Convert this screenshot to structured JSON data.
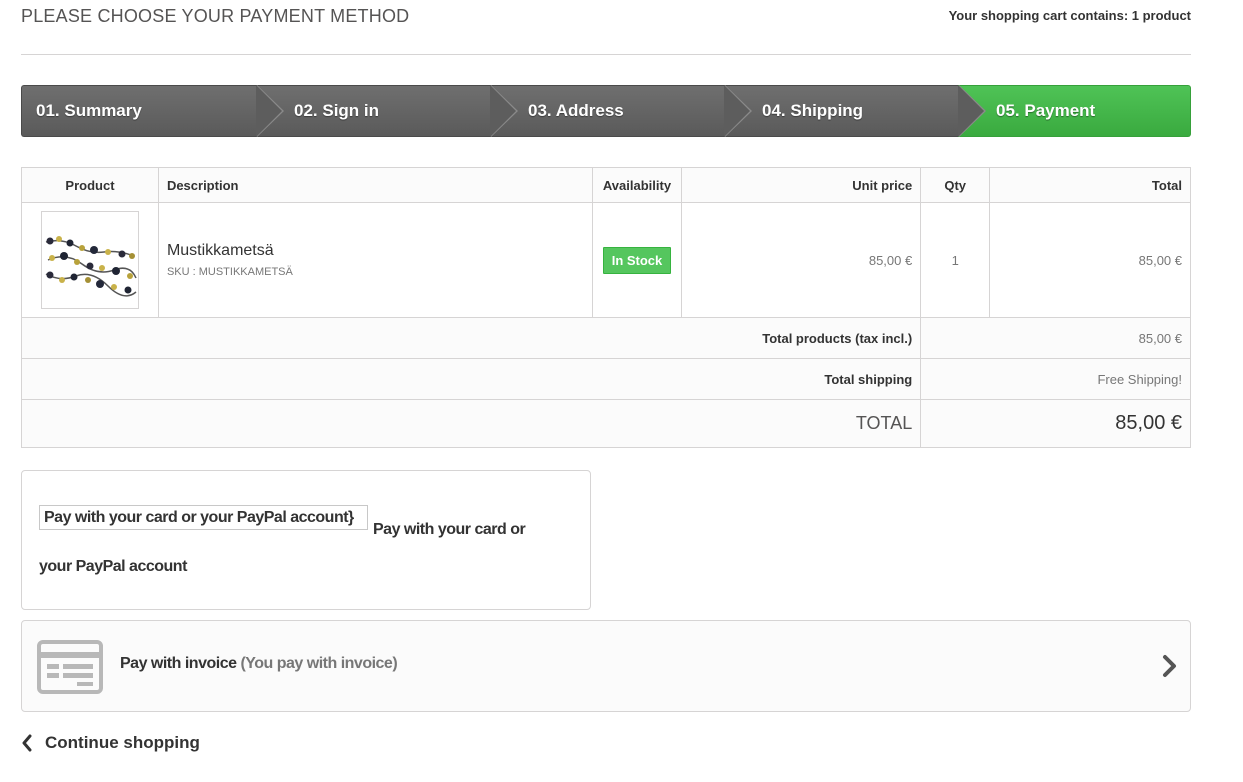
{
  "page": {
    "title": "Please choose your payment method",
    "cart_summary": "Your shopping cart contains: 1 product"
  },
  "steps": [
    {
      "label": "01. Summary",
      "state": "done"
    },
    {
      "label": "02. Sign in",
      "state": "done"
    },
    {
      "label": "03. Address",
      "state": "done"
    },
    {
      "label": "04. Shipping",
      "state": "done"
    },
    {
      "label": "05. Payment",
      "state": "current"
    }
  ],
  "table": {
    "headers": {
      "product": "Product",
      "description": "Description",
      "availability": "Availability",
      "unit_price": "Unit price",
      "qty": "Qty",
      "total": "Total"
    },
    "item": {
      "name": "Mustikkametsä",
      "sku": "SKU : MUSTIKKAMETSÄ",
      "availability": "In Stock",
      "unit_price": "85,00 €",
      "qty": "1",
      "total": "85,00 €"
    },
    "totals": {
      "products_label": "Total products (tax incl.)",
      "products_value": "85,00 €",
      "shipping_label": "Total shipping",
      "shipping_value": "Free Shipping!",
      "grand_label": "Total",
      "grand_value": "85,00 €"
    }
  },
  "payment": {
    "paypal": {
      "image_alt": "Pay with your card or your PayPal account}",
      "label": "Pay with your card or your PayPal account"
    },
    "invoice": {
      "label": "Pay with invoice",
      "sublabel": "(You pay with invoice)",
      "icon": "invoice-card-icon"
    }
  },
  "footer": {
    "continue_label": "Continue shopping"
  },
  "colors": {
    "step_done": "#616161",
    "step_current": "#46b64c",
    "in_stock": "#55c65e",
    "border": "#d6d4d4"
  }
}
